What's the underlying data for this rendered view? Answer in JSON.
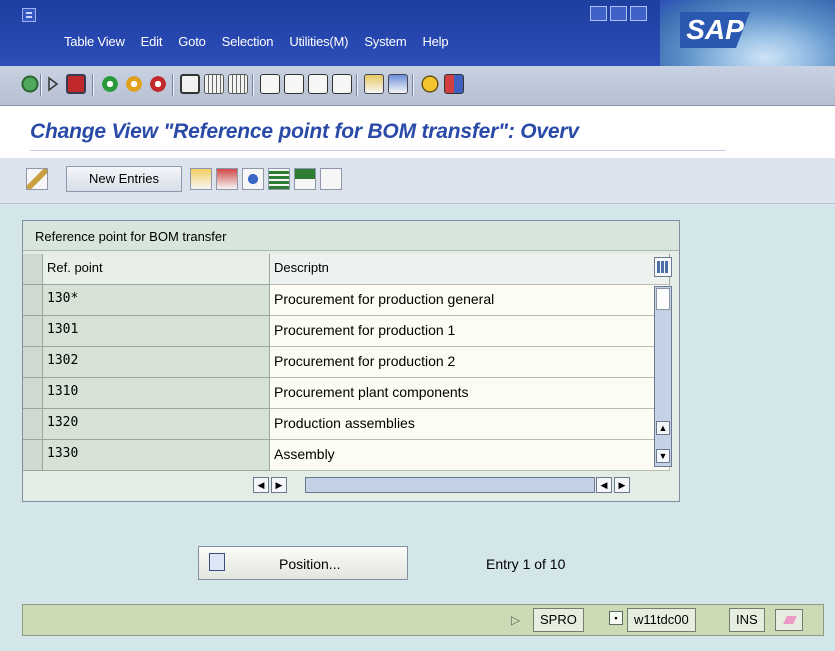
{
  "menubar": {
    "items": [
      "Table View",
      "Edit",
      "Goto",
      "Selection",
      "Utilities(M)",
      "System",
      "Help"
    ]
  },
  "logo": {
    "text": "SAP"
  },
  "standard_toolbar": {
    "icons": [
      "enter-icon",
      "command-field-icon",
      "save-icon",
      "back-icon",
      "exit-icon",
      "cancel-icon",
      "print-icon",
      "find-icon",
      "find-next-icon",
      "first-page-icon",
      "previous-page-icon",
      "next-page-icon",
      "last-page-icon",
      "create-session-icon",
      "create-shortcut-icon",
      "help-icon",
      "layout-menu-icon"
    ]
  },
  "title": "Change View \"Reference point for BOM transfer\": Overv",
  "app_toolbar": {
    "new_entries_label": "New Entries",
    "icons": [
      "change-display-icon",
      "copy-as-icon",
      "delete-icon",
      "undo-change-icon",
      "select-all-icon",
      "select-block-icon",
      "deselect-all-icon"
    ]
  },
  "table": {
    "caption": "Reference point for BOM transfer",
    "columns": [
      "Ref. point",
      "Descriptn"
    ],
    "rows": [
      {
        "ref": "130*",
        "desc": "Procurement for production general"
      },
      {
        "ref": "1301",
        "desc": "Procurement for production 1"
      },
      {
        "ref": "1302",
        "desc": "Procurement for production 2"
      },
      {
        "ref": "1310",
        "desc": "Procurement plant components"
      },
      {
        "ref": "1320",
        "desc": "Production assemblies"
      },
      {
        "ref": "1330",
        "desc": "Assembly"
      }
    ]
  },
  "position_button": {
    "label": "Position..."
  },
  "entry_info": "Entry 1 of 10",
  "statusbar": {
    "transaction": "SPRO",
    "server": "w11tdc00",
    "mode": "INS"
  },
  "colors": {
    "title_bar": "#2747b0",
    "title_text": "#2a4aa8",
    "workarea": "#d3e6ea",
    "statusbar": "#ccdbb6"
  }
}
